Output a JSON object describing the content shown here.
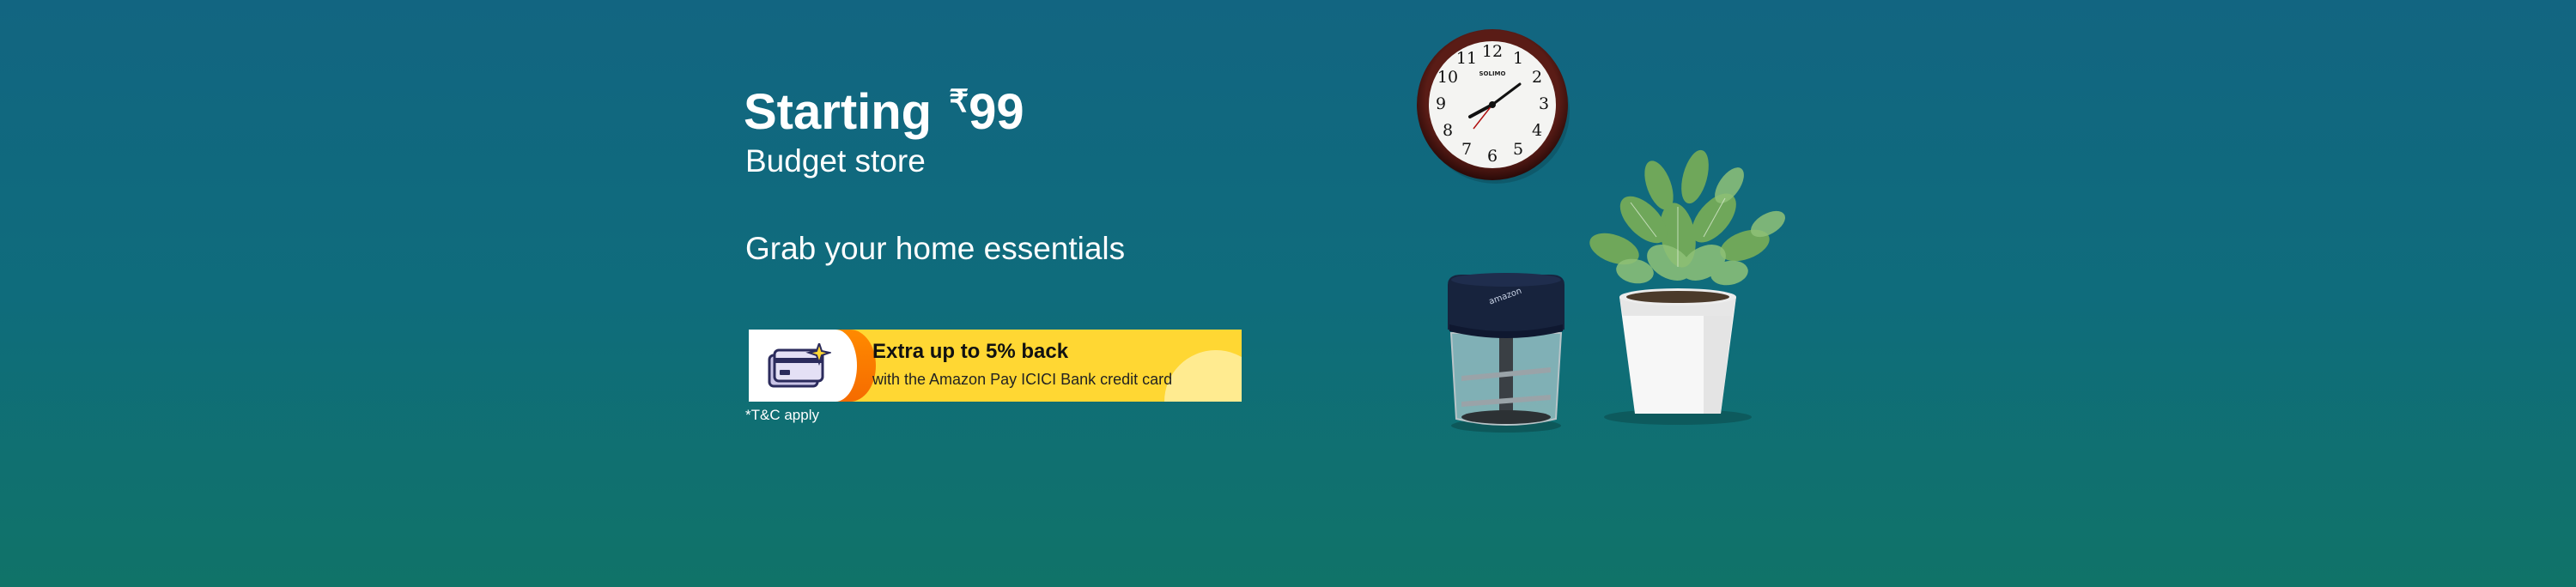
{
  "banner": {
    "headline_prefix": "Starting",
    "rupee_symbol": "₹",
    "price": "99",
    "subtitle": "Budget store",
    "tagline": "Grab your home essentials",
    "offer": {
      "title": "Extra up to 5% back",
      "description": "with the Amazon Pay ICICI Bank credit card"
    },
    "tnc": "*T&C apply",
    "clock_brand": "SOLIMO",
    "clock_numbers": [
      "12",
      "1",
      "2",
      "3",
      "4",
      "5",
      "6",
      "7",
      "8",
      "9",
      "10",
      "11"
    ],
    "chopper_brand": "amazon"
  },
  "colors": {
    "background_top": "#126581",
    "background_bottom": "#107368",
    "offer_yellow": "#ffd733",
    "offer_orange": "#f56b00",
    "text": "#ffffff"
  },
  "icons": [
    "credit-card-icon",
    "sparkle-icon"
  ]
}
